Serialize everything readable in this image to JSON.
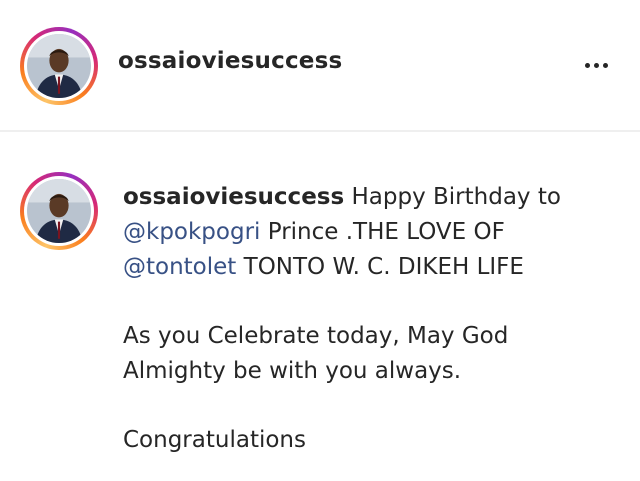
{
  "post": {
    "author": {
      "username": "ossaioviesuccess"
    },
    "more_icon": "ellipsis-horizontal-icon"
  },
  "caption": {
    "username": "ossaioviesuccess",
    "line1_text": " Happy Birthday to",
    "mention1": "@kpokpogri",
    "line2_text": " Prince .THE LOVE OF",
    "mention2": "@tontolet",
    "line3_text": " TONTO W. C. DIKEH LIFE",
    "paragraph2_line1": "As you Celebrate today, May God",
    "paragraph2_line2": "Almighty be with you always.",
    "paragraph3": "Congratulations"
  },
  "colors": {
    "mention": "#385185",
    "text": "#262626",
    "divider": "#efefef"
  }
}
